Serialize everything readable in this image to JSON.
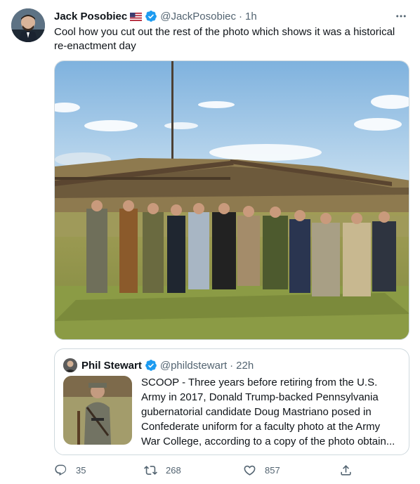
{
  "tweet": {
    "author_name": "Jack Posobiec",
    "author_handle": "@JackPosobiec",
    "separator": "·",
    "time": "1h",
    "flag_icon": "us-flag-icon",
    "text": "Cool how you cut out the rest of the photo which shows it was a historical re-enactment day"
  },
  "quoted": {
    "author_name": "Phil Stewart",
    "author_handle": "@phildstewart",
    "separator": "·",
    "time": "22h",
    "text_lines": [
      "SCOOP - Three years before retiring from the U.S.",
      "Army in 2017, Donald Trump-backed Pennsylvania",
      "gubernatorial candidate Doug Mastriano posed in",
      "Confederate uniform for a faculty photo at the Army",
      "War College, according to a copy of the photo obtain..."
    ]
  },
  "actions": {
    "replies": "35",
    "retweets": "268",
    "likes": "857"
  },
  "colors": {
    "verified": "#1d9bf0",
    "secondary_text": "#536471",
    "border": "#cfd9de"
  }
}
